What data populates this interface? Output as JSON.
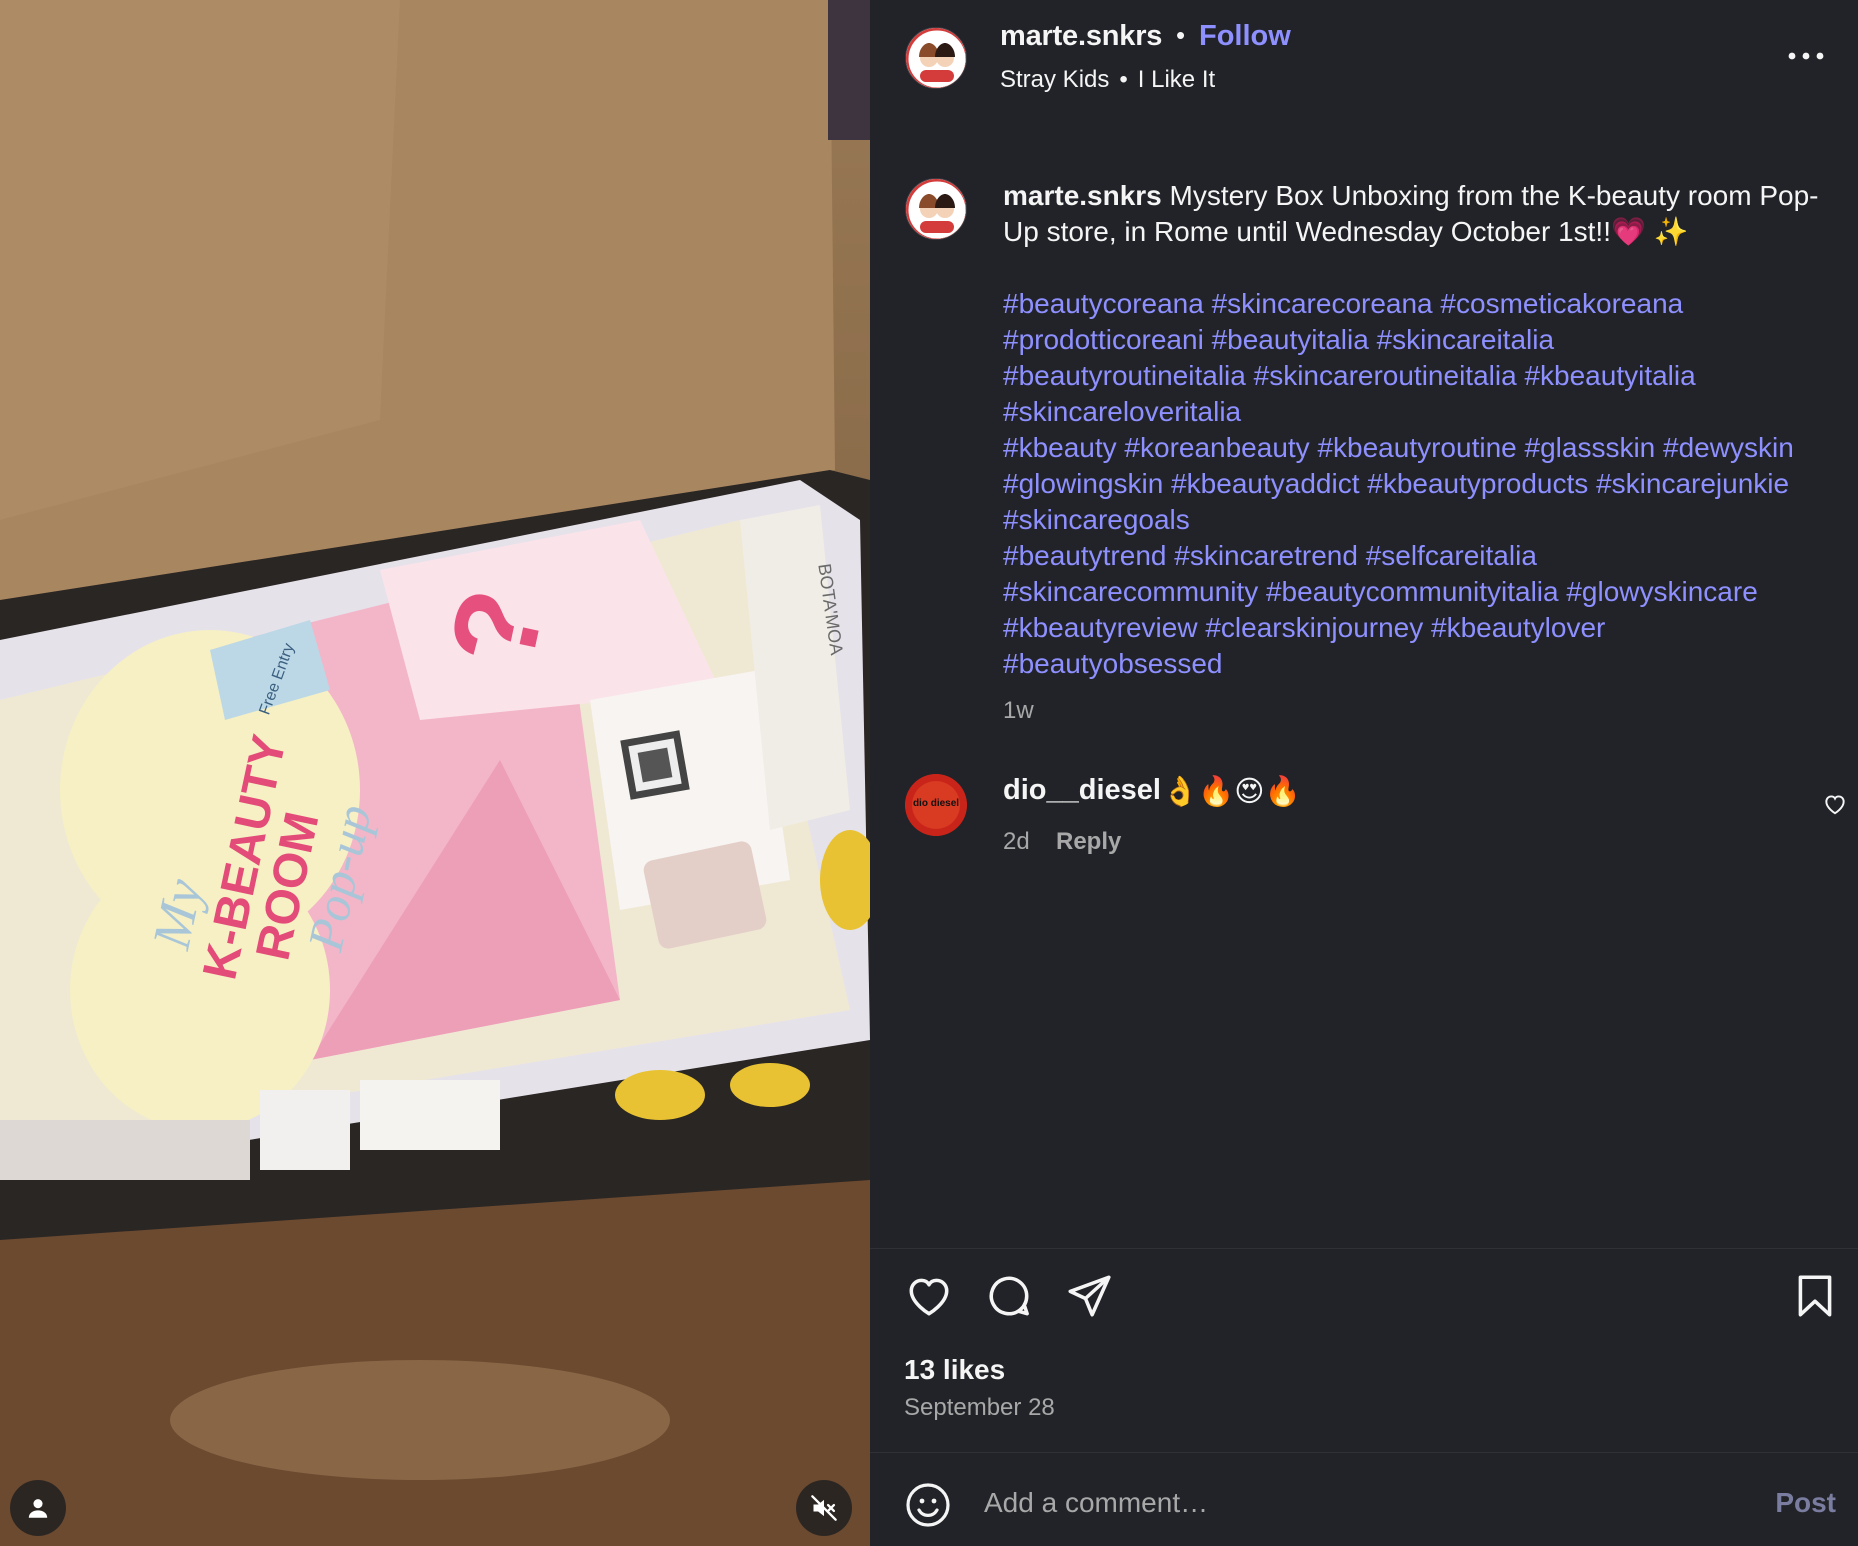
{
  "post": {
    "username": "marte.snkrs",
    "follow_label": "Follow",
    "dot": "•",
    "audio": {
      "artist": "Stray Kids",
      "separator": "•",
      "track": "I Like It"
    },
    "caption_username": "marte.snkrs",
    "caption_text": "Mystery Box Unboxing from the K-beauty room Pop-Up store, in Rome until Wednesday October 1st!!💗 ✨",
    "hashtag_lines": [
      [
        "#beautycoreana",
        "#skincarecoreana",
        "#cosmeticakoreana"
      ],
      [
        "#prodotticoreani",
        "#beautyitalia",
        "#skincareitalia"
      ],
      [
        "#beautyroutineitalia",
        "#skincareroutineitalia",
        "#kbeautyitalia"
      ],
      [
        "#skincareloveritalia"
      ],
      [
        "#kbeauty",
        "#koreanbeauty",
        "#kbeautyroutine",
        "#glassskin",
        "#dewyskin"
      ],
      [
        "#glowingskin",
        "#kbeautyaddict",
        "#kbeautyproducts",
        "#skincarejunkie"
      ],
      [
        "#skincaregoals"
      ],
      [
        "#beautytrend",
        "#skincaretrend",
        "#selfcareitalia"
      ],
      [
        "#skincarecommunity",
        "#beautycommunityitalia",
        "#glowyskincare"
      ],
      [
        "#kbeautyreview",
        "#clearskinjourney",
        "#kbeautylover"
      ],
      [
        "#beautyobsessed"
      ]
    ],
    "caption_time": "1w",
    "likes": "13 likes",
    "date": "September 28"
  },
  "comments": [
    {
      "username": "dio__diesel",
      "text": "👌🔥😍🔥",
      "time": "2d",
      "reply_label": "Reply",
      "avatar_text": "dio diesel"
    }
  ],
  "comment_bar": {
    "placeholder": "Add a comment…",
    "post_label": "Post"
  },
  "media": {
    "box_texts": {
      "title_line1": "My",
      "title_line2": "K-BEAUTY",
      "title_line3": "ROOM",
      "title_line4": "Pop-up",
      "free_entry": "Free Entry",
      "brand": "BOTA'MOA"
    }
  },
  "colors": {
    "panel_bg": "#212328",
    "link": "#8e90ff",
    "muted": "#a8a8a8"
  },
  "icons": [
    "more-options-icon",
    "heart-icon",
    "comment-icon",
    "share-icon",
    "bookmark-icon",
    "emoji-icon",
    "tag-user-icon",
    "muted-speaker-icon"
  ]
}
